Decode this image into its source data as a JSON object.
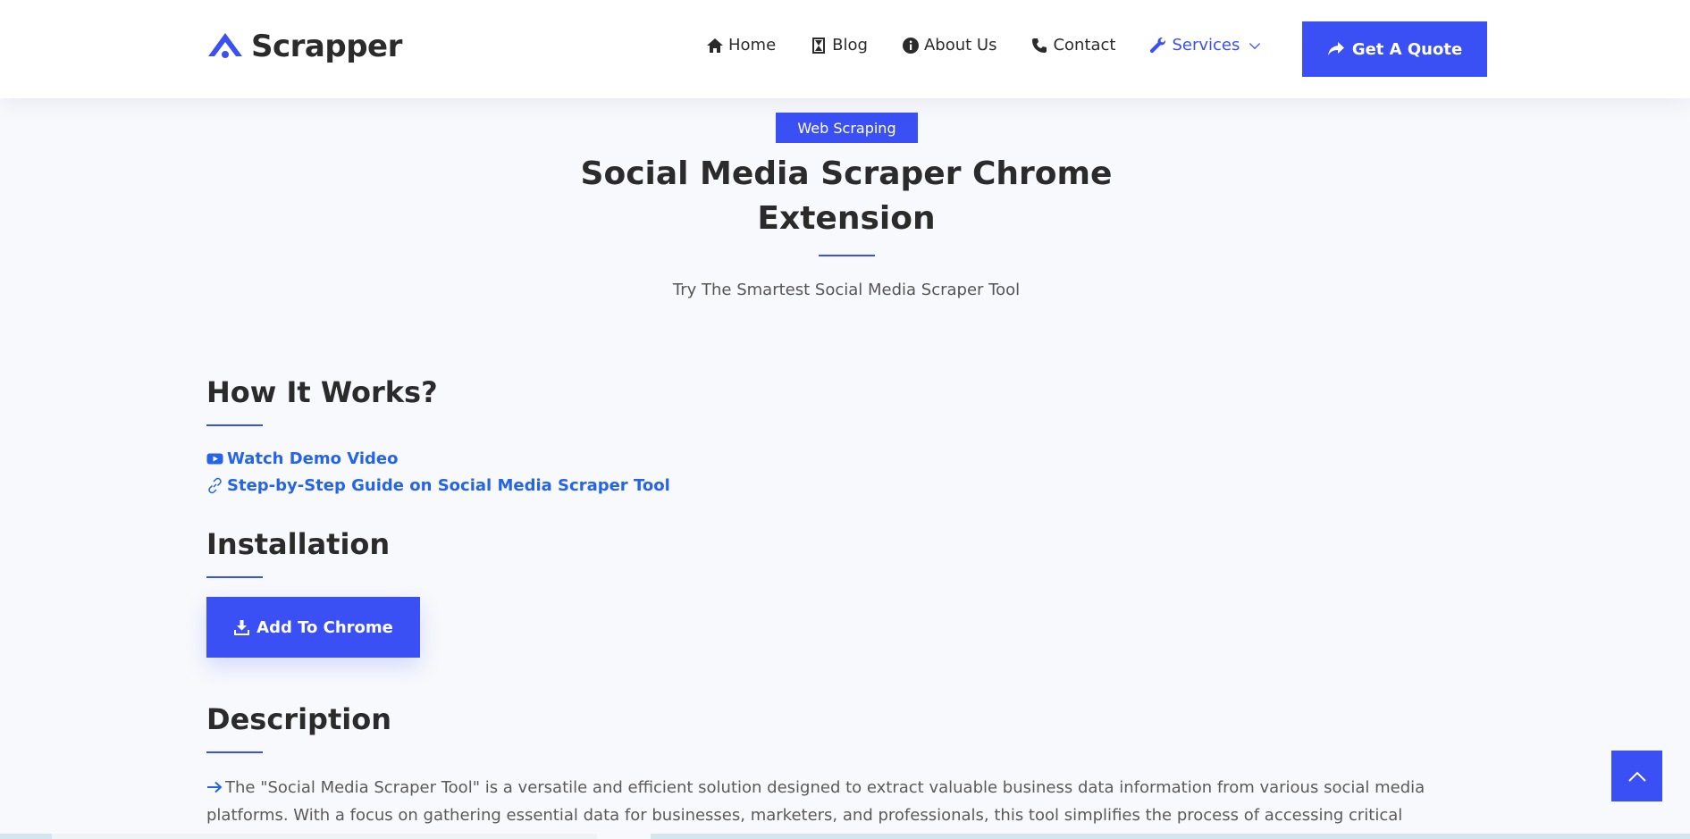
{
  "brand": {
    "name": "Scrapper",
    "icon": "home-roof-icon",
    "color": "#3a50f5"
  },
  "nav": {
    "items": [
      {
        "label": "Home",
        "icon": "home-icon"
      },
      {
        "label": "Blog",
        "icon": "hourglass-icon"
      },
      {
        "label": "About Us",
        "icon": "info-icon"
      },
      {
        "label": "Contact",
        "icon": "phone-icon"
      },
      {
        "label": "Services",
        "icon": "wrench-icon",
        "active": true,
        "dropdown": true
      }
    ],
    "cta": {
      "label": "Get A Quote",
      "icon": "share-icon"
    }
  },
  "hero": {
    "badge": "Web Scraping",
    "title": "Social Media Scraper Chrome Extension",
    "subtitle": "Try The Smartest Social Media Scraper Tool"
  },
  "how_it_works": {
    "heading": "How It Works?",
    "links": [
      {
        "label": "Watch Demo Video",
        "icon": "youtube-icon"
      },
      {
        "label": "Step-by-Step Guide on Social Media Scraper Tool",
        "icon": "link-icon"
      }
    ]
  },
  "installation": {
    "heading": "Installation",
    "button": {
      "label": "Add To Chrome",
      "icon": "download-icon"
    }
  },
  "description": {
    "heading": "Description",
    "text": "The \"Social Media Scraper Tool\" is a versatile and efficient solution designed to extract valuable business data information from various social media platforms. With a focus on gathering essential data for businesses, marketers, and professionals, this tool simplifies the process of accessing critical information to support a"
  },
  "colors": {
    "accent": "#3a50f5",
    "link": "#2563eb",
    "background": "#f8f9fd",
    "text": "#2b2b2b"
  }
}
